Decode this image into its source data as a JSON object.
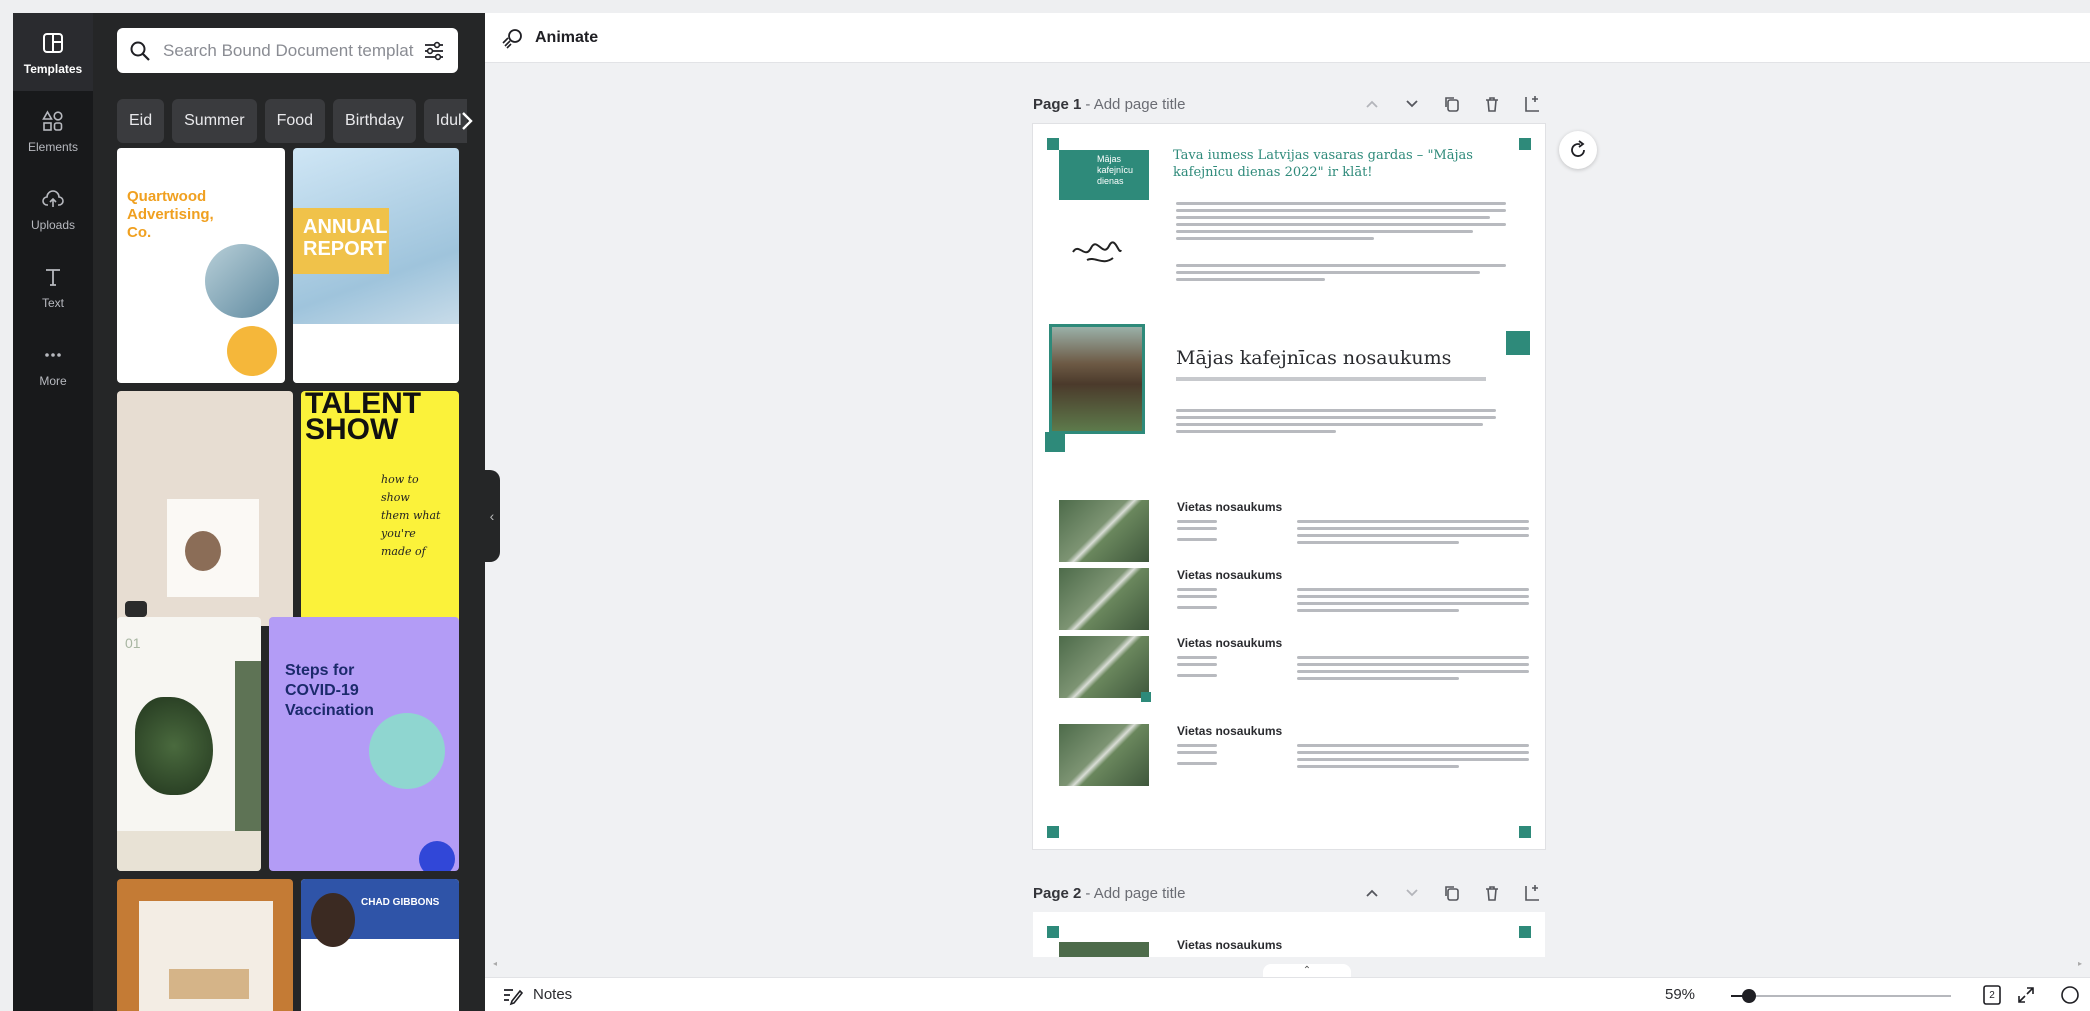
{
  "colors": {
    "rail": "#18191b",
    "panel": "#252627",
    "teal": "#2e8a7a",
    "canvas": "#f0f1f3"
  },
  "rail": {
    "items": [
      {
        "label": "Templates",
        "icon": "templates-icon",
        "active": true
      },
      {
        "label": "Elements",
        "icon": "elements-icon"
      },
      {
        "label": "Uploads",
        "icon": "uploads-icon"
      },
      {
        "label": "Text",
        "icon": "text-icon"
      },
      {
        "label": "More",
        "icon": "more-icon"
      }
    ]
  },
  "panel": {
    "search_placeholder": "Search Bound Document templat",
    "chips": [
      "Eid",
      "Summer",
      "Food",
      "Birthday",
      "Idul"
    ],
    "templates": [
      {
        "text": "Quartwood Advertising, Co."
      },
      {
        "text": "ANNUAL REPORT"
      },
      {
        "text": ""
      },
      {
        "text": "TALENT SHOW"
      },
      {
        "text": "01"
      },
      {
        "text": "Steps for COVID-19 Vaccination"
      },
      {
        "text": ""
      },
      {
        "text": "CHAD GIBBONS"
      }
    ]
  },
  "toolbar": {
    "animate_label": "Animate"
  },
  "pages": [
    {
      "label": "Page 1",
      "title_placeholder": "- Add page title"
    },
    {
      "label": "Page 2",
      "title_placeholder": "- Add page title"
    }
  ],
  "doc": {
    "logo_text": "Mājas kafejnīcu dienas",
    "intro_heading": "Tava iumess Latvijas vasaras gardas – \"Mājas kafejnīcu dienas 2022\" ir klāt!",
    "cafe_name": "Mājas kafejnīcas nosaukums",
    "venue_name": "Vietas nosaukums",
    "venue_count": 4
  },
  "bottombar": {
    "notes_label": "Notes",
    "zoom": "59%",
    "zoom_fraction": 0.08,
    "page_count": "2"
  }
}
